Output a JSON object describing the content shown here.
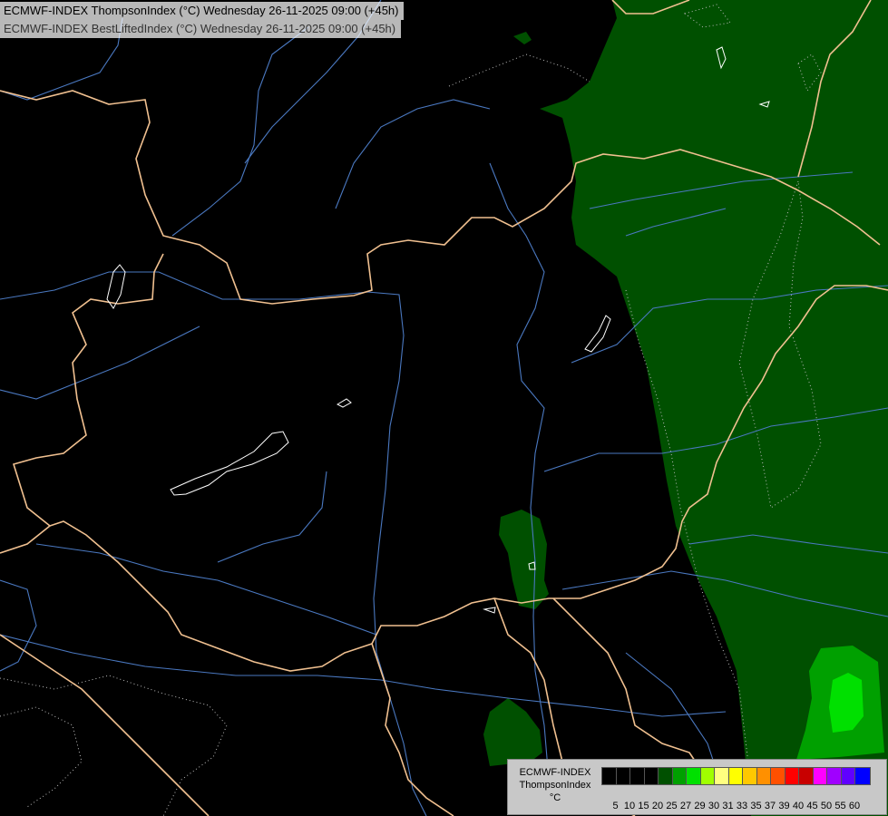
{
  "header": {
    "line1": "ECMWF-INDEX ThompsonIndex (°C) Wednesday 26-11-2025 09:00 (+45h)",
    "line2": "ECMWF-INDEX BestLiftedIndex (°C) Wednesday 26-11-2025 09:00 (+45h)"
  },
  "legend": {
    "model": "ECMWF-INDEX",
    "parameter": "ThompsonIndex",
    "unit": "°C",
    "labels": [
      "5",
      "10",
      "15",
      "20",
      "25",
      "27",
      "29",
      "30",
      "31",
      "33",
      "35",
      "37",
      "39",
      "40",
      "45",
      "50",
      "55",
      "60"
    ],
    "colors": [
      "#000000",
      "#000000",
      "#000000",
      "#000000",
      "#005000",
      "#00a000",
      "#00e000",
      "#a0ff00",
      "#ffff80",
      "#ffff00",
      "#ffc800",
      "#ff9000",
      "#ff5000",
      "#ff0000",
      "#c80000",
      "#ff00ff",
      "#a000ff",
      "#6000ff",
      "#0000ff"
    ]
  },
  "map_colors": {
    "background": "#000000",
    "shade_25": "#005000",
    "shade_27": "#00a000",
    "shade_29": "#00e000",
    "borders": "#f0c090",
    "rivers": "#4a78c0",
    "lakes": "#ffffff",
    "contour": "#bbbbbb"
  }
}
